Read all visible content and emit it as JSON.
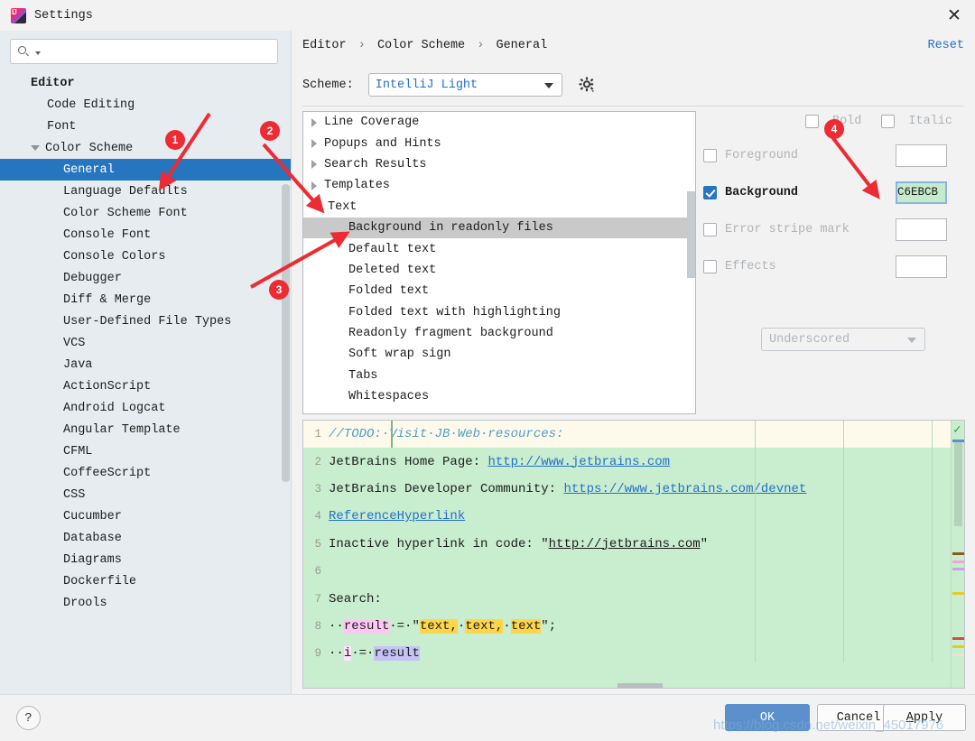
{
  "window": {
    "title": "Settings",
    "app_icon": "intellij-idea-icon",
    "close_icon": "close-icon"
  },
  "sidebar": {
    "search": {
      "placeholder": "",
      "value": "",
      "icon": "search-icon"
    },
    "items": [
      {
        "label": "Editor",
        "level": 0,
        "arrow": "none",
        "selected": false
      },
      {
        "label": "Code Editing",
        "level": 1,
        "arrow": "none",
        "selected": false
      },
      {
        "label": "Font",
        "level": 1,
        "arrow": "none",
        "selected": false
      },
      {
        "label": "Color Scheme",
        "level": 1,
        "arrow": "expanded",
        "selected": false
      },
      {
        "label": "General",
        "level": 2,
        "arrow": "none",
        "selected": true
      },
      {
        "label": "Language Defaults",
        "level": 2,
        "arrow": "none",
        "selected": false
      },
      {
        "label": "Color Scheme Font",
        "level": 2,
        "arrow": "none",
        "selected": false
      },
      {
        "label": "Console Font",
        "level": 2,
        "arrow": "none",
        "selected": false
      },
      {
        "label": "Console Colors",
        "level": 2,
        "arrow": "none",
        "selected": false
      },
      {
        "label": "Debugger",
        "level": 2,
        "arrow": "none",
        "selected": false
      },
      {
        "label": "Diff & Merge",
        "level": 2,
        "arrow": "none",
        "selected": false
      },
      {
        "label": "User-Defined File Types",
        "level": 2,
        "arrow": "none",
        "selected": false
      },
      {
        "label": "VCS",
        "level": 2,
        "arrow": "none",
        "selected": false
      },
      {
        "label": "Java",
        "level": 2,
        "arrow": "none",
        "selected": false
      },
      {
        "label": "ActionScript",
        "level": 2,
        "arrow": "none",
        "selected": false
      },
      {
        "label": "Android Logcat",
        "level": 2,
        "arrow": "none",
        "selected": false
      },
      {
        "label": "Angular Template",
        "level": 2,
        "arrow": "none",
        "selected": false
      },
      {
        "label": "CFML",
        "level": 2,
        "arrow": "none",
        "selected": false
      },
      {
        "label": "CoffeeScript",
        "level": 2,
        "arrow": "none",
        "selected": false
      },
      {
        "label": "CSS",
        "level": 2,
        "arrow": "none",
        "selected": false
      },
      {
        "label": "Cucumber",
        "level": 2,
        "arrow": "none",
        "selected": false
      },
      {
        "label": "Database",
        "level": 2,
        "arrow": "none",
        "selected": false
      },
      {
        "label": "Diagrams",
        "level": 2,
        "arrow": "none",
        "selected": false
      },
      {
        "label": "Dockerfile",
        "level": 2,
        "arrow": "none",
        "selected": false
      },
      {
        "label": "Drools",
        "level": 2,
        "arrow": "none",
        "selected": false
      }
    ]
  },
  "header": {
    "breadcrumb": [
      "Editor",
      "Color Scheme",
      "General"
    ],
    "separator": "›",
    "reset_label": "Reset",
    "scheme_label": "Scheme:",
    "scheme_value": "IntelliJ Light",
    "gear_icon": "gear-icon",
    "dropdown_icon": "chevron-down-icon"
  },
  "attribute_tree": {
    "items": [
      {
        "label": "Line Coverage",
        "type": "group",
        "arrow": "collapsed",
        "selected": false
      },
      {
        "label": "Popups and Hints",
        "type": "group",
        "arrow": "collapsed",
        "selected": false
      },
      {
        "label": "Search Results",
        "type": "group",
        "arrow": "collapsed",
        "selected": false
      },
      {
        "label": "Templates",
        "type": "group",
        "arrow": "collapsed",
        "selected": false
      },
      {
        "label": "Text",
        "type": "group",
        "arrow": "expanded",
        "selected": false
      },
      {
        "label": "Background in readonly files",
        "type": "leaf",
        "arrow": "none",
        "selected": true
      },
      {
        "label": "Default text",
        "type": "leaf",
        "arrow": "none",
        "selected": false
      },
      {
        "label": "Deleted text",
        "type": "leaf",
        "arrow": "none",
        "selected": false
      },
      {
        "label": "Folded text",
        "type": "leaf",
        "arrow": "none",
        "selected": false
      },
      {
        "label": "Folded text with highlighting",
        "type": "leaf",
        "arrow": "none",
        "selected": false
      },
      {
        "label": "Readonly fragment background",
        "type": "leaf",
        "arrow": "none",
        "selected": false
      },
      {
        "label": "Soft wrap sign",
        "type": "leaf",
        "arrow": "none",
        "selected": false
      },
      {
        "label": "Tabs",
        "type": "leaf",
        "arrow": "none",
        "selected": false
      },
      {
        "label": "Whitespaces",
        "type": "leaf",
        "arrow": "none",
        "selected": false
      }
    ]
  },
  "attributes": {
    "bold_label": "Bold",
    "bold_checked": false,
    "italic_label": "Italic",
    "italic_checked": false,
    "foreground_label": "Foreground",
    "foreground_checked": false,
    "foreground_value": "",
    "background_label": "Background",
    "background_checked": true,
    "background_value": "C6EBCB",
    "background_color": "#C6EBCB",
    "error_stripe_label": "Error stripe mark",
    "error_stripe_checked": false,
    "error_stripe_value": "",
    "effects_label": "Effects",
    "effects_checked": false,
    "effects_value": "",
    "effects_type": "Underscored"
  },
  "preview": {
    "background_color": "#C9EDCF",
    "todo_line_color": "#FDFAEC",
    "lines": [
      {
        "no": "1",
        "kind": "comment",
        "text": "//TODO:·Visit·JB·Web·resources:"
      },
      {
        "no": "2",
        "kind": "link",
        "text": "JetBrains Home Page: ",
        "link": "http://www.jetbrains.com"
      },
      {
        "no": "3",
        "kind": "link",
        "text": "JetBrains Developer Community: ",
        "link": "https://www.jetbrains.com/devnet"
      },
      {
        "no": "4",
        "kind": "reflink",
        "text": "ReferenceHyperlink"
      },
      {
        "no": "5",
        "kind": "inactive",
        "text": "Inactive hyperlink in code: \"",
        "link": "http://jetbrains.com",
        "tail": "\""
      },
      {
        "no": "6",
        "kind": "blank",
        "text": ""
      },
      {
        "no": "7",
        "kind": "plain",
        "text": "Search:"
      },
      {
        "no": "8",
        "kind": "search",
        "text": "result = \"text, text, text\";"
      },
      {
        "no": "9",
        "kind": "search2",
        "text": "i = result"
      }
    ],
    "mark_ok_icon": "checkmark-icon"
  },
  "footer": {
    "help_label": "?",
    "ok_label": "OK",
    "cancel_label": "Cancel",
    "apply_label": "Apply"
  },
  "annotations": {
    "badges": [
      "1",
      "2",
      "3",
      "4"
    ],
    "color": "#EC2B32"
  },
  "watermark": "https://blog.csdn.net/weixin_45017976"
}
